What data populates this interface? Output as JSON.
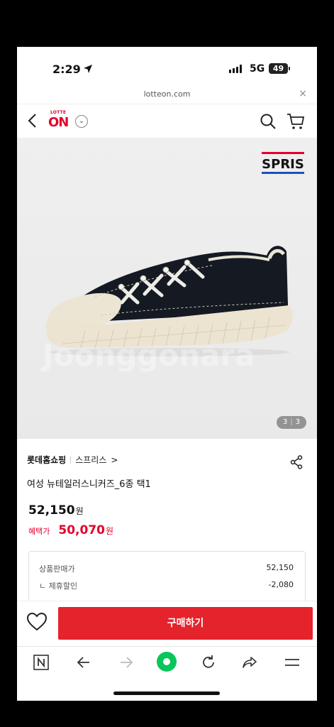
{
  "status_bar": {
    "time": "2:29",
    "network": "5G",
    "battery": "49"
  },
  "browser": {
    "url": "lotteon.com",
    "close_glyph": "×"
  },
  "header": {
    "logo_top": "LOTTE",
    "logo_main": "ON",
    "logo_dropdown_glyph": "⌄"
  },
  "product_image": {
    "brand_logo": "SPRIS",
    "watermark": "Joonggonara",
    "page_current": "3",
    "page_total": "3"
  },
  "product": {
    "seller": "롯데홈쇼핑",
    "brand": "스프리스",
    "brand_chevron": ">",
    "title": "여성 뉴테일러스니커즈_6종 택1",
    "price": "52,150",
    "price_unit": "원",
    "benefit_label": "혜택가",
    "benefit_price": "50,070",
    "benefit_unit": "원"
  },
  "breakdown": {
    "row1_label": "상품판매가",
    "row1_value": "52,150",
    "row2_label": "ㄴ 제휴할인",
    "row2_value": "-2,080"
  },
  "buy_bar": {
    "buy_label": "구매하기"
  },
  "colors": {
    "accent": "#e4232c",
    "brand_red": "#e4002b"
  }
}
